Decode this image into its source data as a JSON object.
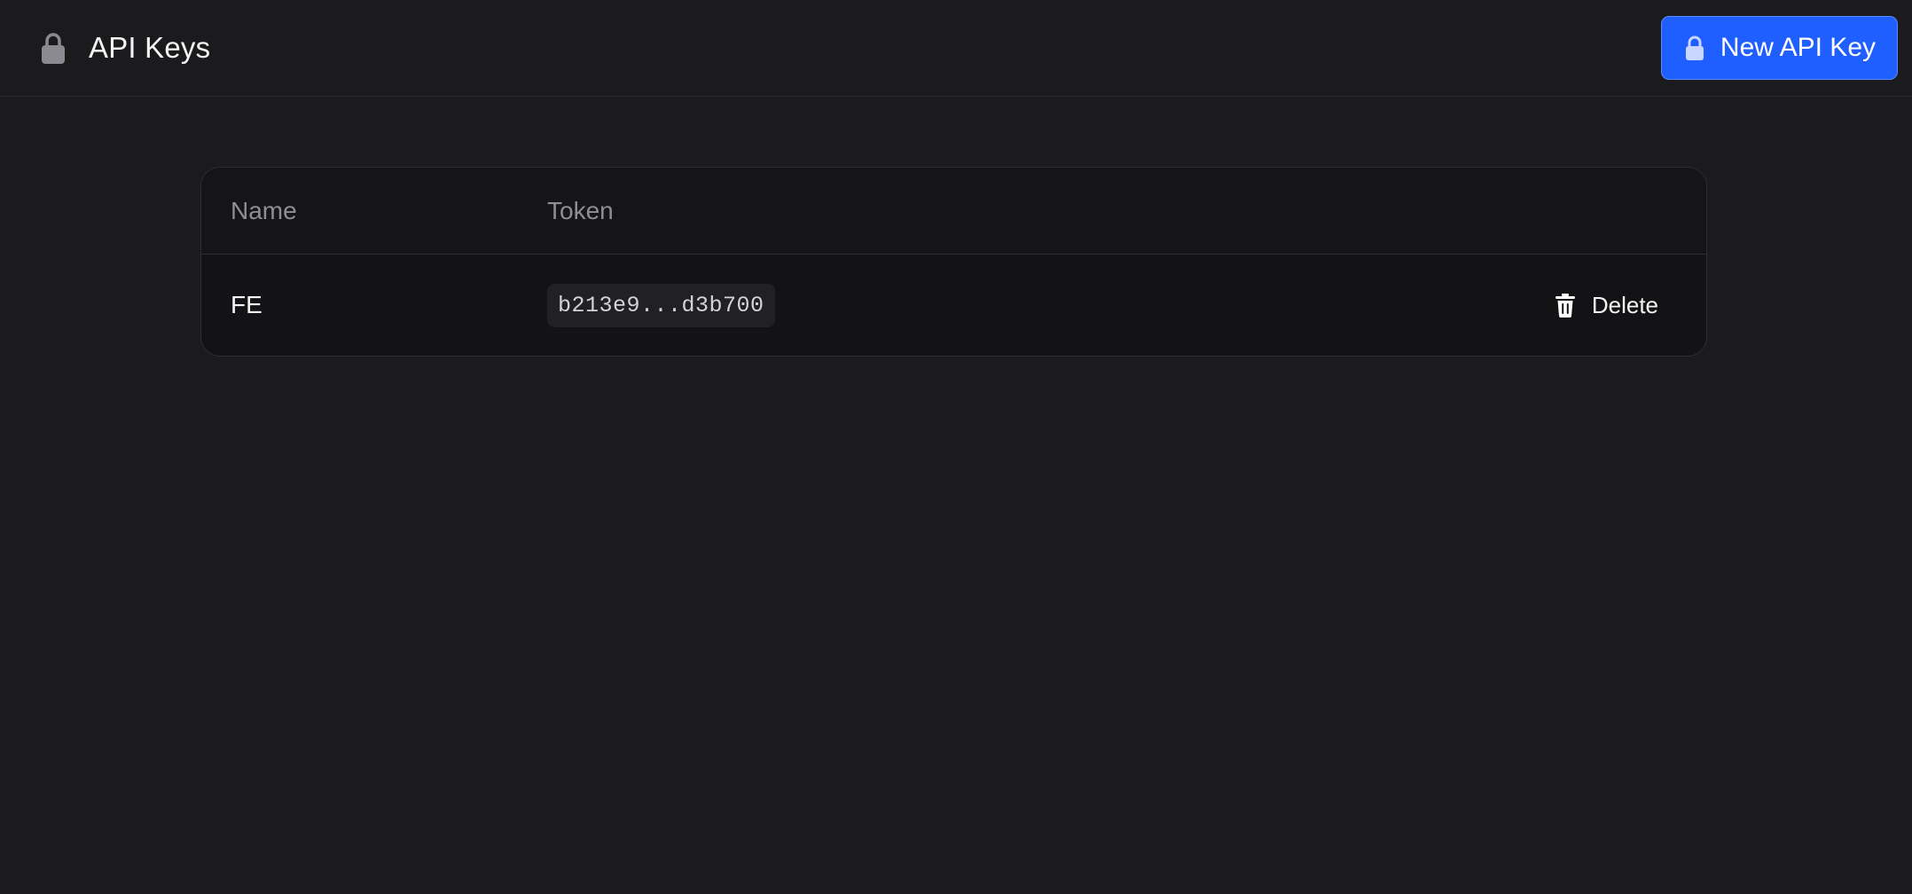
{
  "header": {
    "title": "API Keys",
    "title_icon": "lock-icon",
    "new_button_label": "New API Key",
    "new_button_icon": "lock-icon"
  },
  "table": {
    "columns": [
      "Name",
      "Token"
    ],
    "rows": [
      {
        "name": "FE",
        "token": "b213e9...d3b700",
        "action_label": "Delete",
        "action_icon": "trash-icon"
      }
    ]
  },
  "colors": {
    "background": "#1b1b1d",
    "card": "#131315",
    "accent": "#1f5eff",
    "muted_text": "#8e8e96"
  }
}
